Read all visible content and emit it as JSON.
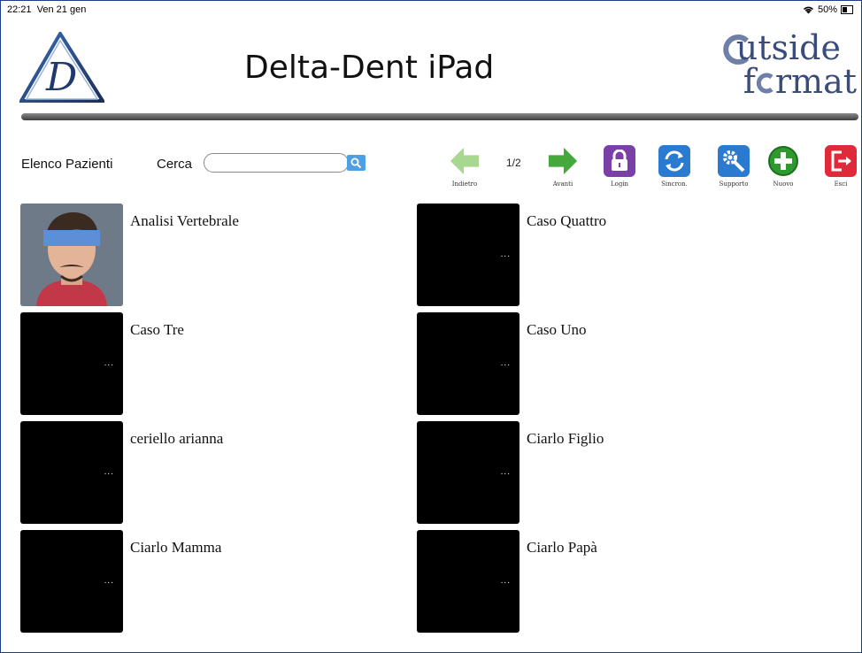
{
  "status_bar": {
    "time": "22:21",
    "date": "Ven 21 gen",
    "battery": "50%"
  },
  "header": {
    "title": "Delta-Dent iPad",
    "brand_line1": "utside",
    "brand_line2": "f",
    "brand_line3": "rmat"
  },
  "toolbar": {
    "list_label": "Elenco Pazienti",
    "search_label": "Cerca",
    "search_value": "",
    "page_indicator": "1/2",
    "buttons": {
      "back": "Indietro",
      "next": "Avanti",
      "login": "Login",
      "sync": "Sincron.",
      "support": "Supporto",
      "new": "Nuovo",
      "exit": "Esci"
    }
  },
  "patients": [
    {
      "name": "Analisi Vertebrale",
      "has_photo": true
    },
    {
      "name": "Caso Quattro",
      "has_photo": false
    },
    {
      "name": "Caso Tre",
      "has_photo": false
    },
    {
      "name": "Caso Uno",
      "has_photo": false
    },
    {
      "name": "ceriello arianna",
      "has_photo": false
    },
    {
      "name": "Ciarlo Figlio",
      "has_photo": false
    },
    {
      "name": "Ciarlo Mamma",
      "has_photo": false
    },
    {
      "name": "Ciarlo Papà",
      "has_photo": false
    }
  ],
  "more_dots": "...",
  "colors": {
    "frame": "#1d3e8c",
    "back_arrow": "#a8d890",
    "next_arrow": "#44a83a",
    "login": "#7b3fa8",
    "sync": "#2a7ad0",
    "support": "#2a7ad0",
    "new": "#2e9a2e",
    "exit": "#e02a3a"
  }
}
